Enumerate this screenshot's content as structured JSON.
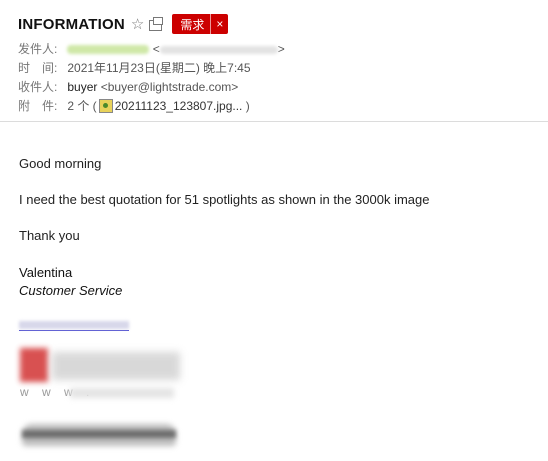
{
  "header": {
    "subject": "INFORMATION",
    "tag_label": "需求",
    "tag_close": "×",
    "from_label": "发件人:",
    "from_suffix": ">",
    "from_bracket": "<",
    "time_label": "时　间:",
    "time_value": "2021年11月23日(星期二) 晚上7:45",
    "to_label": "收件人:",
    "to_name": "buyer",
    "to_email": "<buyer@lightstrade.com>",
    "attach_label": "附　件:",
    "attach_count": "2 个 (",
    "attach_file": "20211123_123807.jpg...",
    "attach_close": ")"
  },
  "message": {
    "greeting": "Good morning",
    "line1": "I need the best quotation for 51 spotlights as shown in the 3000k image",
    "thanks": "Thank you"
  },
  "signature": {
    "name": "Valentina",
    "role": "Customer Service",
    "www": "w w w ."
  },
  "icons": {
    "star": "star-icon",
    "popout": "popout-icon",
    "attachment": "image-file-icon"
  },
  "colors": {
    "tag_bg": "#cc0000",
    "link_underline": "#4a4ad0"
  }
}
